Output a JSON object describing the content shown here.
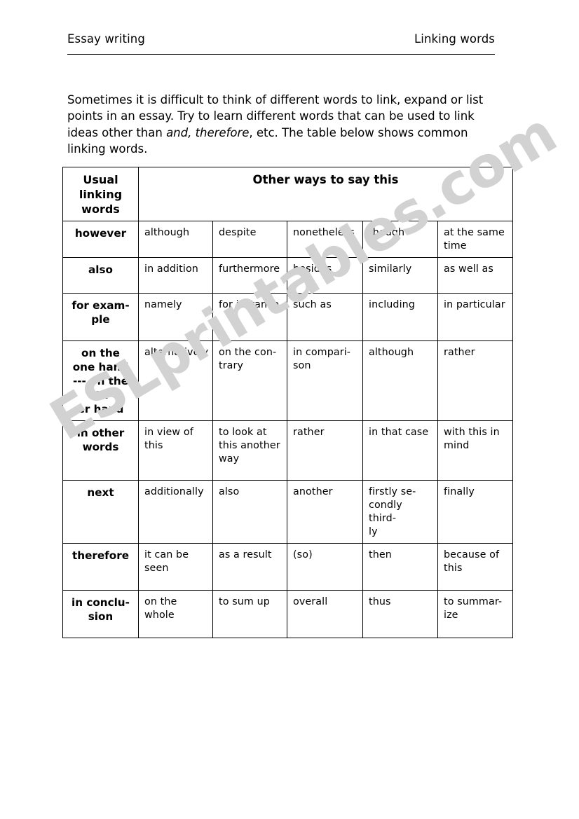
{
  "header": {
    "left_title": "Essay writing",
    "right_title": "Linking words"
  },
  "intro": {
    "part1": "Sometimes it is difficult to think of different words to link, expand or list points in an essay. Try to learn different words that can be used to link ideas other than ",
    "italic1": "and, therefore",
    "part2": ", etc. The table below shows common linking words."
  },
  "watermark": {
    "text": "ESLprintables.com",
    "color": "#d2d2d2"
  },
  "table": {
    "headers": {
      "col0": "Usual linking words",
      "span": "Other ways to say this"
    },
    "rows": [
      {
        "key": "however",
        "values": [
          "although",
          "despite",
          "nonetheless",
          "though",
          "at the same time"
        ]
      },
      {
        "key": "also",
        "values": [
          "in addition",
          "furthermore",
          "besides",
          "similarly",
          "as well as"
        ]
      },
      {
        "key": "for exam-\nple",
        "values": [
          "namely",
          "for instance",
          "such as",
          "including",
          "in particular"
        ]
      },
      {
        "key": "on the one hand --- on the oth-\ner hand",
        "values": [
          "alternatively",
          "on the con-\ntrary",
          "in compari-\nson",
          "although",
          "rather"
        ]
      },
      {
        "key": "in other words",
        "values": [
          "in view of this",
          "to look at this another way",
          "rather",
          "in that case",
          "with this in mind"
        ]
      },
      {
        "key": "next",
        "values": [
          "additionally",
          "also",
          "another",
          "firstly se-\ncondly third-\nly",
          "finally"
        ]
      },
      {
        "key": "therefore",
        "values": [
          "it can be seen",
          "as a result",
          "(so)",
          "then",
          "because of this"
        ]
      },
      {
        "key": "in conclu-\nsion",
        "values": [
          "on the whole",
          "to sum up",
          "overall",
          "thus",
          "to summar-\nize"
        ]
      }
    ]
  }
}
